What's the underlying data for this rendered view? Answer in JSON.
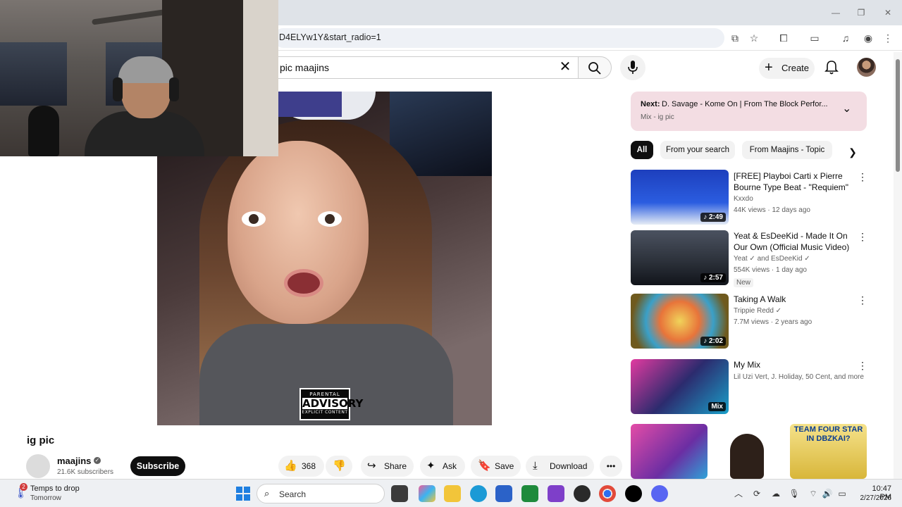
{
  "browser": {
    "url": "D4ELYw1Y&start_radio=1",
    "window_controls": {
      "minimize": "—",
      "maximize": "❐",
      "close": "✕"
    },
    "toolbar_icons": [
      "install-icon",
      "star-icon",
      "extensions-icon",
      "cast-icon",
      "media-icon",
      "profile-icon",
      "menu-icon"
    ]
  },
  "header": {
    "search_value": "pic maajins",
    "clear_glyph": "✕",
    "create_label": "Create",
    "create_glyph": "+"
  },
  "video": {
    "title": "ig pic",
    "advisory": {
      "top": "PARENTAL",
      "mid": "ADVISORY",
      "bottom": "EXPLICIT CONTENT"
    }
  },
  "channel": {
    "name": "maajins",
    "subscribers": "21.6K subscribers",
    "subscribe_label": "Subscribe"
  },
  "actions": {
    "likes": "368",
    "share": "Share",
    "ask": "Ask",
    "save": "Save",
    "download": "Download",
    "more": "•••"
  },
  "sidebar": {
    "next": {
      "label": "Next:",
      "title": "D. Savage - Kome On | From The Block Perfor...",
      "sub": "Mix - ig pic"
    },
    "chips": [
      "All",
      "From your search",
      "From Maajins - Topic"
    ],
    "recommendations": [
      {
        "title": "[FREE] Playboi Carti x Pierre Bourne Type Beat - \"Requiem\"",
        "channel": "Kxxdo",
        "meta": "44K views · 12 days ago",
        "duration": "♪ 2:49",
        "badge": ""
      },
      {
        "title": "Yeat & EsDeeKid - Made It On Our Own (Official Music Video)",
        "channel": "Yeat ✓ and EsDeeKid ✓",
        "meta": "554K views · 1 day ago",
        "duration": "♪ 2:57",
        "badge": "New"
      },
      {
        "title": "Taking A Walk",
        "channel": "Trippie Redd ✓",
        "meta": "7.7M views · 2 years ago",
        "duration": "♪ 2:02",
        "badge": ""
      },
      {
        "title": "My Mix",
        "channel": "Lil Uzi Vert, J. Holiday, 50 Cent, and more",
        "meta": "",
        "duration": "Mix",
        "badge": ""
      }
    ],
    "shorts3_text": "TEAM FOUR STAR IN DBZKAI?"
  },
  "taskbar": {
    "weather_line1": "Temps to drop",
    "weather_line2": "Tomorrow",
    "weather_badge": "2",
    "search_label": "Search",
    "time": "10:47 PM",
    "date": "2/27/2026"
  }
}
